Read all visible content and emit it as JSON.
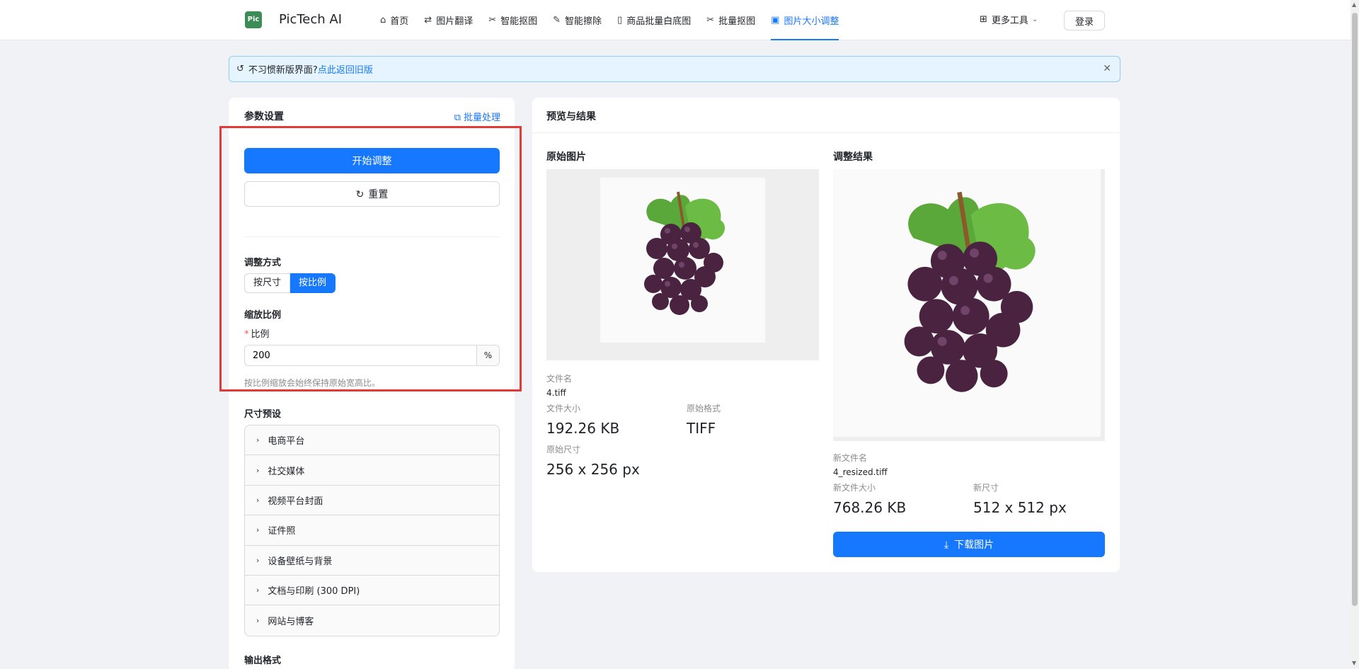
{
  "header": {
    "logo_text": "Pic",
    "brand": "PicTech AI",
    "nav": [
      {
        "label": "首页",
        "icon": "home-icon"
      },
      {
        "label": "图片翻译",
        "icon": "translate-icon"
      },
      {
        "label": "智能抠图",
        "icon": "scissors-icon"
      },
      {
        "label": "智能擦除",
        "icon": "eraser-icon"
      },
      {
        "label": "商品批量白底图",
        "icon": "document-icon"
      },
      {
        "label": "批量抠图",
        "icon": "scissors-icon"
      },
      {
        "label": "图片大小调整",
        "icon": "image-icon",
        "active": true
      }
    ],
    "more_tools": "更多工具",
    "login": "登录"
  },
  "notice": {
    "text": "不习惯新版界面?",
    "link": "点此返回旧版"
  },
  "settings": {
    "title": "参数设置",
    "batch": "批量处理",
    "start_button": "开始调整",
    "reset_button": "重置",
    "mode_label": "调整方式",
    "mode_options": [
      "按尺寸",
      "按比例"
    ],
    "mode_selected": "按比例",
    "scale_label": "缩放比例",
    "ratio_label": "比例",
    "ratio_value": "200",
    "ratio_unit": "%",
    "hint": "按比例缩放会始终保持原始宽高比。",
    "presets_label": "尺寸预设",
    "presets": [
      "电商平台",
      "社交媒体",
      "视频平台封面",
      "证件照",
      "设备壁纸与背景",
      "文档与印刷 (300 DPI)",
      "网站与博客"
    ],
    "output_label": "输出格式"
  },
  "preview": {
    "title": "预览与结果",
    "original": {
      "title": "原始图片",
      "filename_label": "文件名",
      "filename": "4.tiff",
      "size_label": "文件大小",
      "size": "192.26 KB",
      "format_label": "原始格式",
      "format": "TIFF",
      "dims_label": "原始尺寸",
      "dims": "256 x 256 px"
    },
    "result": {
      "title": "调整结果",
      "filename_label": "新文件名",
      "filename": "4_resized.tiff",
      "size_label": "新文件大小",
      "size": "768.26 KB",
      "dims_label": "新尺寸",
      "dims": "512 x 512 px"
    },
    "download": "下载图片"
  },
  "colors": {
    "primary": "#1677ff",
    "highlight": "#e53935",
    "logo": "#3d8b56"
  }
}
